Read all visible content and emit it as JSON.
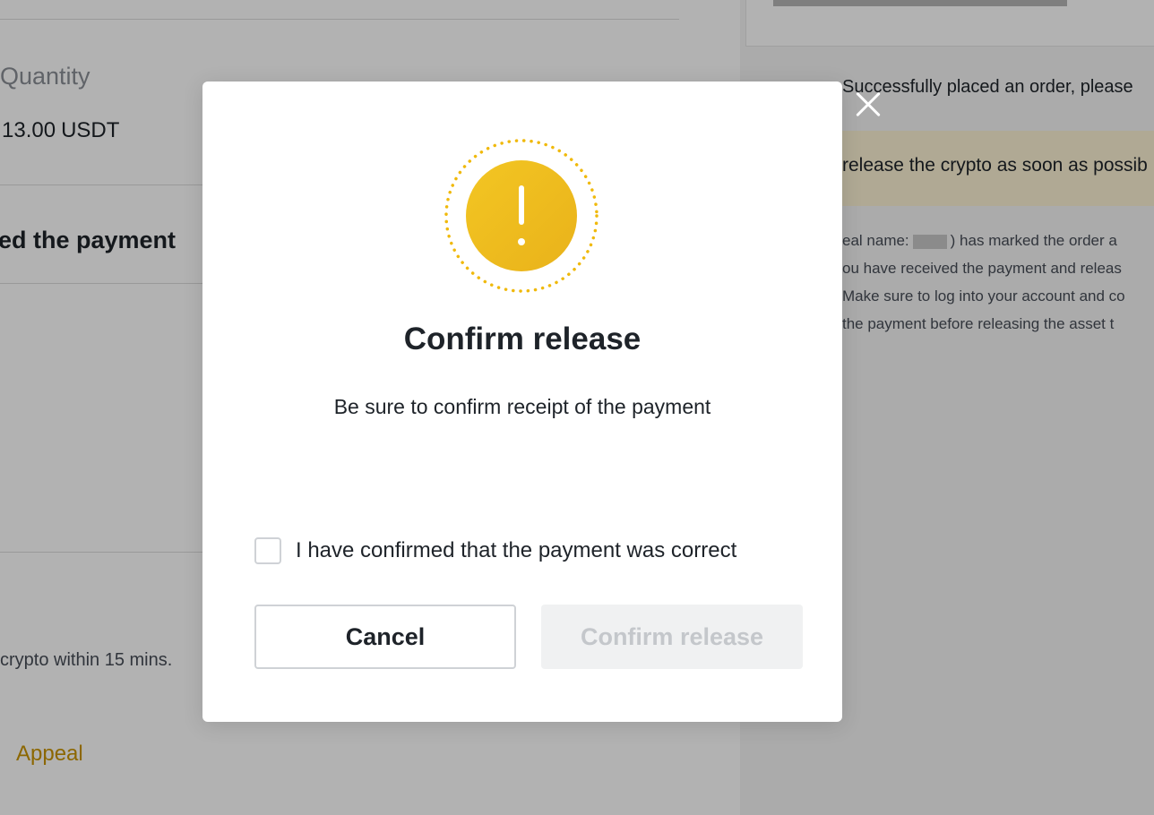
{
  "background": {
    "quantity_label": "Quantity",
    "quantity_value": "13.00",
    "quantity_unit": "USDT",
    "payment_heading": "ed the payment",
    "release_note": "crypto within 15 mins.",
    "appeal_link": "Appeal",
    "success_message": "Successfully placed an order, please",
    "warning_banner": "release the crypto as soon as possib",
    "info_lines": [
      {
        "prefix": "eal name:",
        "suffix": ") has marked the order a"
      },
      "ou have received the payment and releas",
      "Make sure to log into your account and co",
      "the payment before releasing the asset t"
    ]
  },
  "modal": {
    "title": "Confirm release",
    "subtitle": "Be sure to confirm receipt of the payment",
    "checkbox_label": "I have confirmed that the payment was correct",
    "checkbox_checked": false,
    "cancel_label": "Cancel",
    "confirm_label": "Confirm release",
    "confirm_enabled": false,
    "icon": "warning-exclamation-icon",
    "close_icon": "close-icon"
  },
  "colors": {
    "accent_gold": "#F0B90B",
    "link_gold": "#C99400",
    "warning_banner_bg": "#FDF3D4",
    "text_primary": "#1E2329",
    "disabled_button_bg": "#F0F1F2",
    "disabled_button_text": "#C4C7CB"
  }
}
